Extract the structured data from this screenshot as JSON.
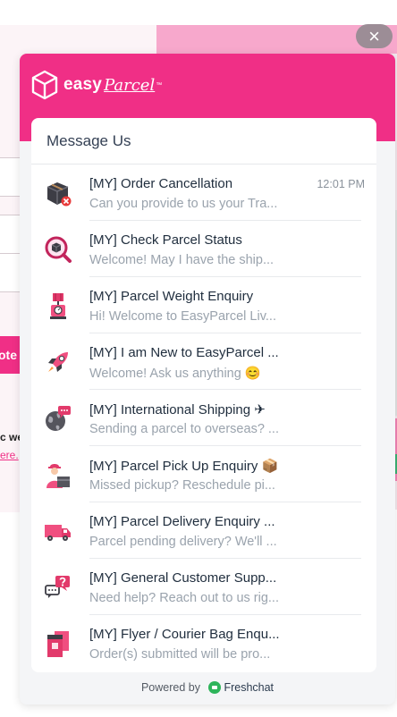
{
  "background": {
    "quote_button": "ote",
    "text_line1": "c we",
    "text_link": "ere."
  },
  "close_icon": "×",
  "brand": {
    "name_part1": "easy",
    "name_part2": "Parcel",
    "trademark": "™"
  },
  "card": {
    "title": "Message Us"
  },
  "conversations": [
    {
      "title": "[MY] Order Cancellation",
      "preview": "Can you provide to us your Tra...",
      "time": "12:01 PM",
      "icon": "package-cancel-icon"
    },
    {
      "title": "[MY] Check Parcel Status",
      "preview": "Welcome! May I have the ship...",
      "time": "",
      "icon": "magnifier-package-icon"
    },
    {
      "title": "[MY] Parcel Weight Enquiry",
      "preview": "Hi! Welcome to EasyParcel Liv...",
      "time": "",
      "icon": "weighing-scale-icon"
    },
    {
      "title": "[MY] I am New to EasyParcel ...",
      "preview": "Welcome! Ask us anything 😊",
      "time": "",
      "icon": "rocket-icon"
    },
    {
      "title": "[MY] International Shipping ✈",
      "preview": "Sending a parcel to overseas? ...",
      "time": "",
      "icon": "globe-chat-icon"
    },
    {
      "title": "[MY] Parcel Pick Up Enquiry 📦",
      "preview": "Missed pickup? Reschedule pi...",
      "time": "",
      "icon": "courier-person-icon"
    },
    {
      "title": "[MY] Parcel Delivery Enquiry ...",
      "preview": "Parcel pending delivery? We'll ...",
      "time": "",
      "icon": "delivery-truck-icon"
    },
    {
      "title": "[MY] General Customer Supp...",
      "preview": "Need help? Reach out to us rig...",
      "time": "",
      "icon": "question-chat-icon"
    },
    {
      "title": "[MY] Flyer / Courier Bag Enqu...",
      "preview": "Order(s) submitted will be pro...",
      "time": "",
      "icon": "flyer-bag-icon"
    }
  ],
  "footer": {
    "powered_by": "Powered by",
    "provider": "Freshchat"
  },
  "colors": {
    "brand_pink": "#f02f86",
    "freshchat_green": "#2db45a"
  }
}
